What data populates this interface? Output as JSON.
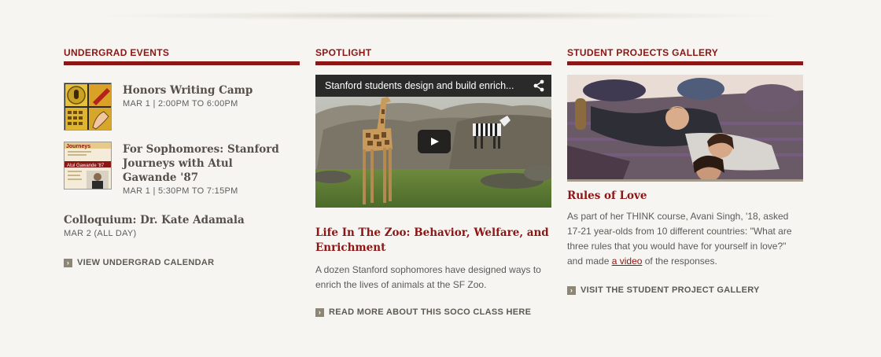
{
  "undergrad": {
    "heading": "UNDERGRAD EVENTS",
    "events": [
      {
        "title": "Honors Writing Camp",
        "meta": "MAR 1 | 2:00PM TO 6:00PM"
      },
      {
        "title": "For Sophomores: Stanford Journeys with Atul Gawande '87",
        "meta": "MAR 1 | 5:30PM TO 7:15PM",
        "thumb_text": "Journeys",
        "thumb_name": "Atul Gawande '87"
      },
      {
        "title": "Colloquium: Dr. Kate Adamala",
        "meta": "MAR 2 (ALL DAY)"
      }
    ],
    "link": "VIEW UNDERGRAD CALENDAR"
  },
  "spotlight": {
    "heading": "SPOTLIGHT",
    "video_title": "Stanford students design and build enrich...",
    "story_title": "Life In The Zoo: Behavior, Welfare, and Enrichment",
    "story_text": "A dozen Stanford sophomores have designed ways to enrich the lives of animals at the SF Zoo.",
    "link": "READ MORE ABOUT THIS SOCO CLASS HERE"
  },
  "gallery": {
    "heading": "STUDENT PROJECTS GALLERY",
    "story_title": "Rules of Love",
    "text_before": "As part of her THINK course, Avani Singh, '18, asked 17-21 year-olds from 10 different countries: \"What are three rules that you would have for yourself in love?\" and made ",
    "link_text": "a video",
    "text_after": " of the responses.",
    "link": "VISIT THE STUDENT PROJECT GALLERY"
  },
  "colors": {
    "cardinal": "#8c1515",
    "background": "#f6f5f1"
  },
  "icons": {
    "link_bullet": "chevron-right-icon",
    "share": "share-icon",
    "play": "play-icon"
  }
}
